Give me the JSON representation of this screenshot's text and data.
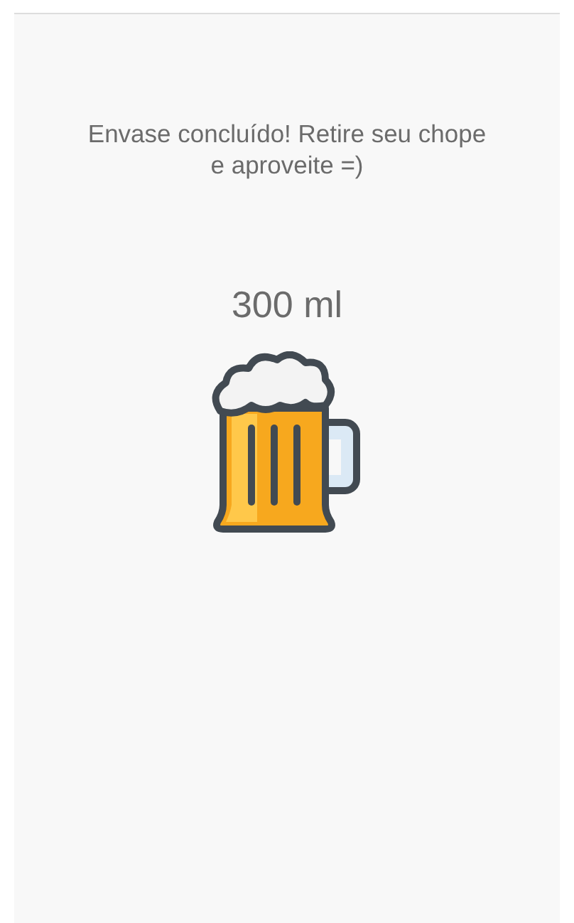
{
  "message": "Envase concluído! Retire seu chope e aproveite =)",
  "volume": "300 ml"
}
